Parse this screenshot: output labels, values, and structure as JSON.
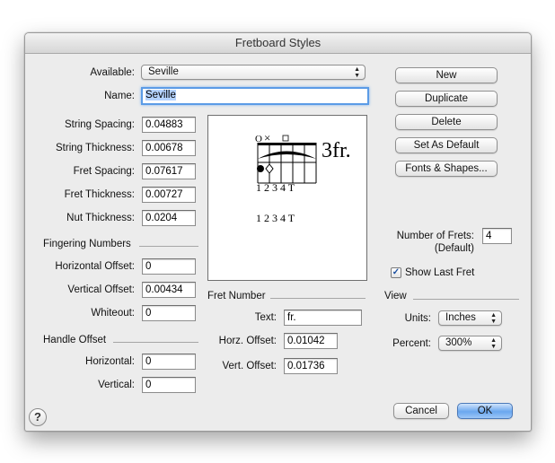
{
  "window": {
    "title": "Fretboard Styles"
  },
  "available": {
    "label": "Available:",
    "value": "Seville"
  },
  "name": {
    "label": "Name:",
    "value": "Seville"
  },
  "fields": [
    {
      "label": "String Spacing:",
      "value": "0.04883"
    },
    {
      "label": "String Thickness:",
      "value": "0.00678"
    },
    {
      "label": "Fret Spacing:",
      "value": "0.07617"
    },
    {
      "label": "Fret Thickness:",
      "value": "0.00727"
    },
    {
      "label": "Nut Thickness:",
      "value": "0.0204"
    }
  ],
  "fingering": {
    "title": "Fingering Numbers",
    "horizontal": {
      "label": "Horizontal Offset:",
      "value": "0"
    },
    "vertical": {
      "label": "Vertical Offset:",
      "value": "0.00434"
    },
    "whiteout": {
      "label": "Whiteout:",
      "value": "0"
    }
  },
  "handle": {
    "title": "Handle Offset",
    "horizontal": {
      "label": "Horizontal:",
      "value": "0"
    },
    "vertical": {
      "label": "Vertical:",
      "value": "0"
    }
  },
  "preview": {
    "fret_label": "3fr.",
    "fingering_top": "1 2 3 4 T",
    "fingering_bottom": "1 2 3 4 T",
    "open_marker": "O",
    "mute_marker": "×"
  },
  "fret_number": {
    "title": "Fret Number",
    "text": {
      "label": "Text:",
      "value": "fr."
    },
    "horz": {
      "label": "Horz. Offset:",
      "value": "0.01042"
    },
    "vert": {
      "label": "Vert. Offset:",
      "value": "0.01736"
    }
  },
  "buttons": {
    "new": "New",
    "duplicate": "Duplicate",
    "delete": "Delete",
    "set_default": "Set As Default",
    "fonts_shapes": "Fonts & Shapes...",
    "cancel": "Cancel",
    "ok": "OK"
  },
  "frets": {
    "label_line1": "Number of Frets:",
    "label_line2": "(Default)",
    "value": "4"
  },
  "show_last_fret": {
    "label": "Show Last Fret",
    "checked": true,
    "mark": "✓"
  },
  "view": {
    "title": "View",
    "units": {
      "label": "Units:",
      "value": "Inches"
    },
    "percent": {
      "label": "Percent:",
      "value": "300%"
    }
  },
  "help": {
    "glyph": "?"
  },
  "icons": {
    "popup_arrows": "⌃⌄"
  },
  "colors": {
    "accent": "#6aa7ef",
    "focus_ring": "#5b9be6",
    "window_bg": "#ececec"
  }
}
